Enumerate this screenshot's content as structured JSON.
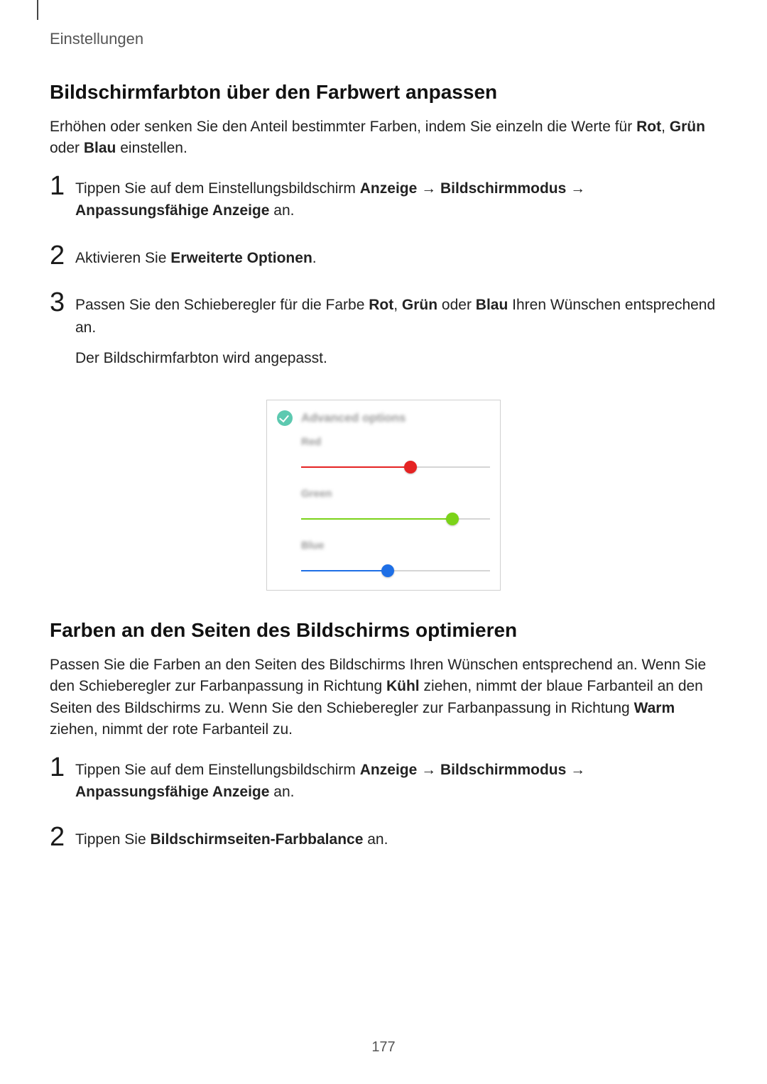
{
  "breadcrumb": "Einstellungen",
  "page_number": "177",
  "section1": {
    "heading": "Bildschirmfarbton über den Farbwert anpassen",
    "intro_parts": [
      "Erhöhen oder senken Sie den Anteil bestimmter Farben, indem Sie einzeln die Werte für ",
      "Rot",
      ", ",
      "Grün",
      " oder ",
      "Blau",
      " einstellen."
    ],
    "steps": [
      {
        "num": "1",
        "body_parts": [
          "Tippen Sie auf dem Einstellungsbildschirm ",
          "Anzeige",
          " → ",
          "Bildschirmmodus",
          " → ",
          "Anpassungsfähige Anzeige",
          " an."
        ]
      },
      {
        "num": "2",
        "body_parts": [
          "Aktivieren Sie ",
          "Erweiterte Optionen",
          "."
        ]
      },
      {
        "num": "3",
        "body_parts": [
          "Passen Sie den Schieberegler für die Farbe ",
          "Rot",
          ", ",
          "Grün",
          " oder ",
          "Blau",
          " Ihren Wünschen entsprechend an."
        ],
        "body2_parts": [
          "Der Bildschirmfarbton wird angepasst."
        ]
      }
    ]
  },
  "illustration": {
    "title_label": "Advanced options",
    "sliders": [
      {
        "label": "Red",
        "color": "#e52323",
        "percent": 58
      },
      {
        "label": "Green",
        "color": "#7bd319",
        "percent": 80
      },
      {
        "label": "Blue",
        "color": "#1e6fe6",
        "percent": 46
      }
    ]
  },
  "section2": {
    "heading": "Farben an den Seiten des Bildschirms optimieren",
    "intro_parts": [
      "Passen Sie die Farben an den Seiten des Bildschirms Ihren Wünschen entsprechend an. Wenn Sie den Schieberegler zur Farbanpassung in Richtung ",
      "Kühl",
      " ziehen, nimmt der blaue Farbanteil an den Seiten des Bildschirms zu. Wenn Sie den Schieberegler zur Farbanpassung in Richtung ",
      "Warm",
      " ziehen, nimmt der rote Farbanteil zu."
    ],
    "steps": [
      {
        "num": "1",
        "body_parts": [
          "Tippen Sie auf dem Einstellungsbildschirm ",
          "Anzeige",
          " → ",
          "Bildschirmmodus",
          " → ",
          "Anpassungsfähige Anzeige",
          " an."
        ]
      },
      {
        "num": "2",
        "body_parts": [
          "Tippen Sie ",
          "Bildschirmseiten-Farbbalance",
          " an."
        ]
      }
    ]
  }
}
